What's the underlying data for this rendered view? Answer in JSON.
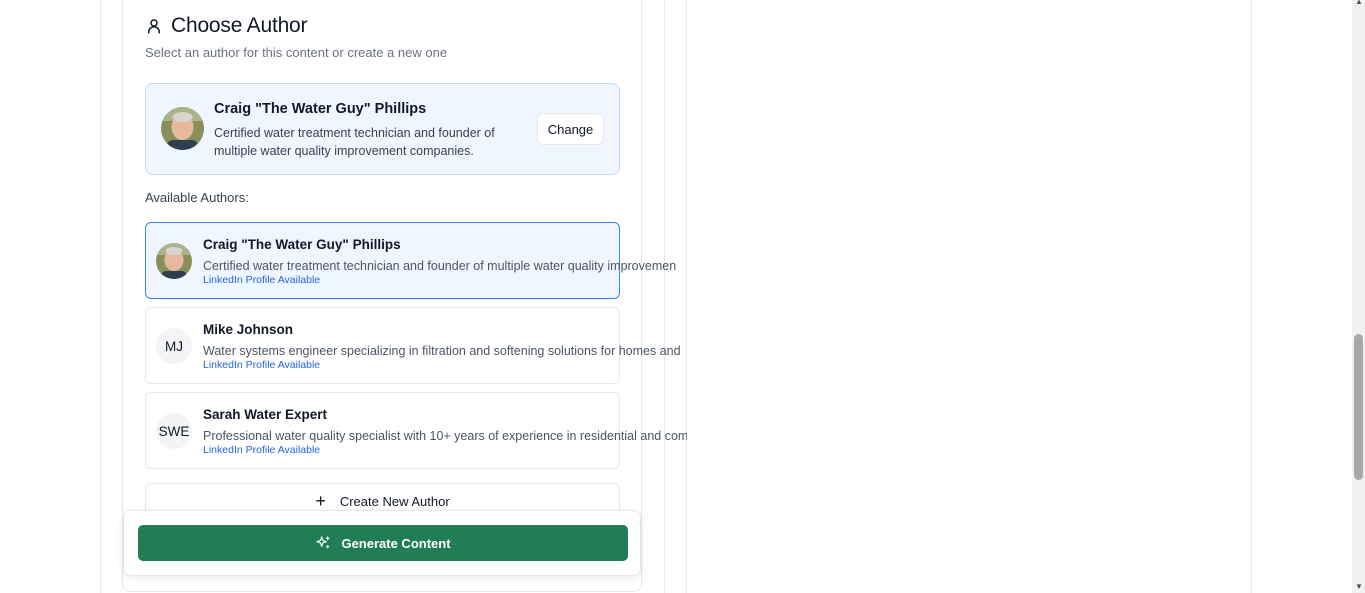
{
  "section": {
    "title": "Choose Author",
    "subtitle": "Select an author for this content or create a new one"
  },
  "selected_author": {
    "name": "Craig \"The Water Guy\" Phillips",
    "bio_line1": "Certified water treatment technician and founder of",
    "bio_line2": "multiple water quality improvement companies.",
    "change_label": "Change"
  },
  "available": {
    "label": "Available Authors:",
    "items": [
      {
        "name": "Craig \"The Water Guy\" Phillips",
        "initials": "",
        "bio": "Certified water treatment technician and founder of multiple water quality improvemen",
        "link": "LinkedIn Profile Available"
      },
      {
        "name": "Mike Johnson",
        "initials": "MJ",
        "bio": "Water systems engineer specializing in filtration and softening solutions for homes and",
        "link": "LinkedIn Profile Available"
      },
      {
        "name": "Sarah Water Expert",
        "initials": "SWE",
        "bio": "Professional water quality specialist with 10+ years of experience in residential and com",
        "link": "LinkedIn Profile Available"
      }
    ]
  },
  "create_label": "Create New Author",
  "generate_label": "Generate Content",
  "colors": {
    "primary": "#217d55",
    "selected_bg": "#eff6ff",
    "selected_border": "#3b82f6",
    "link": "#2563eb"
  }
}
